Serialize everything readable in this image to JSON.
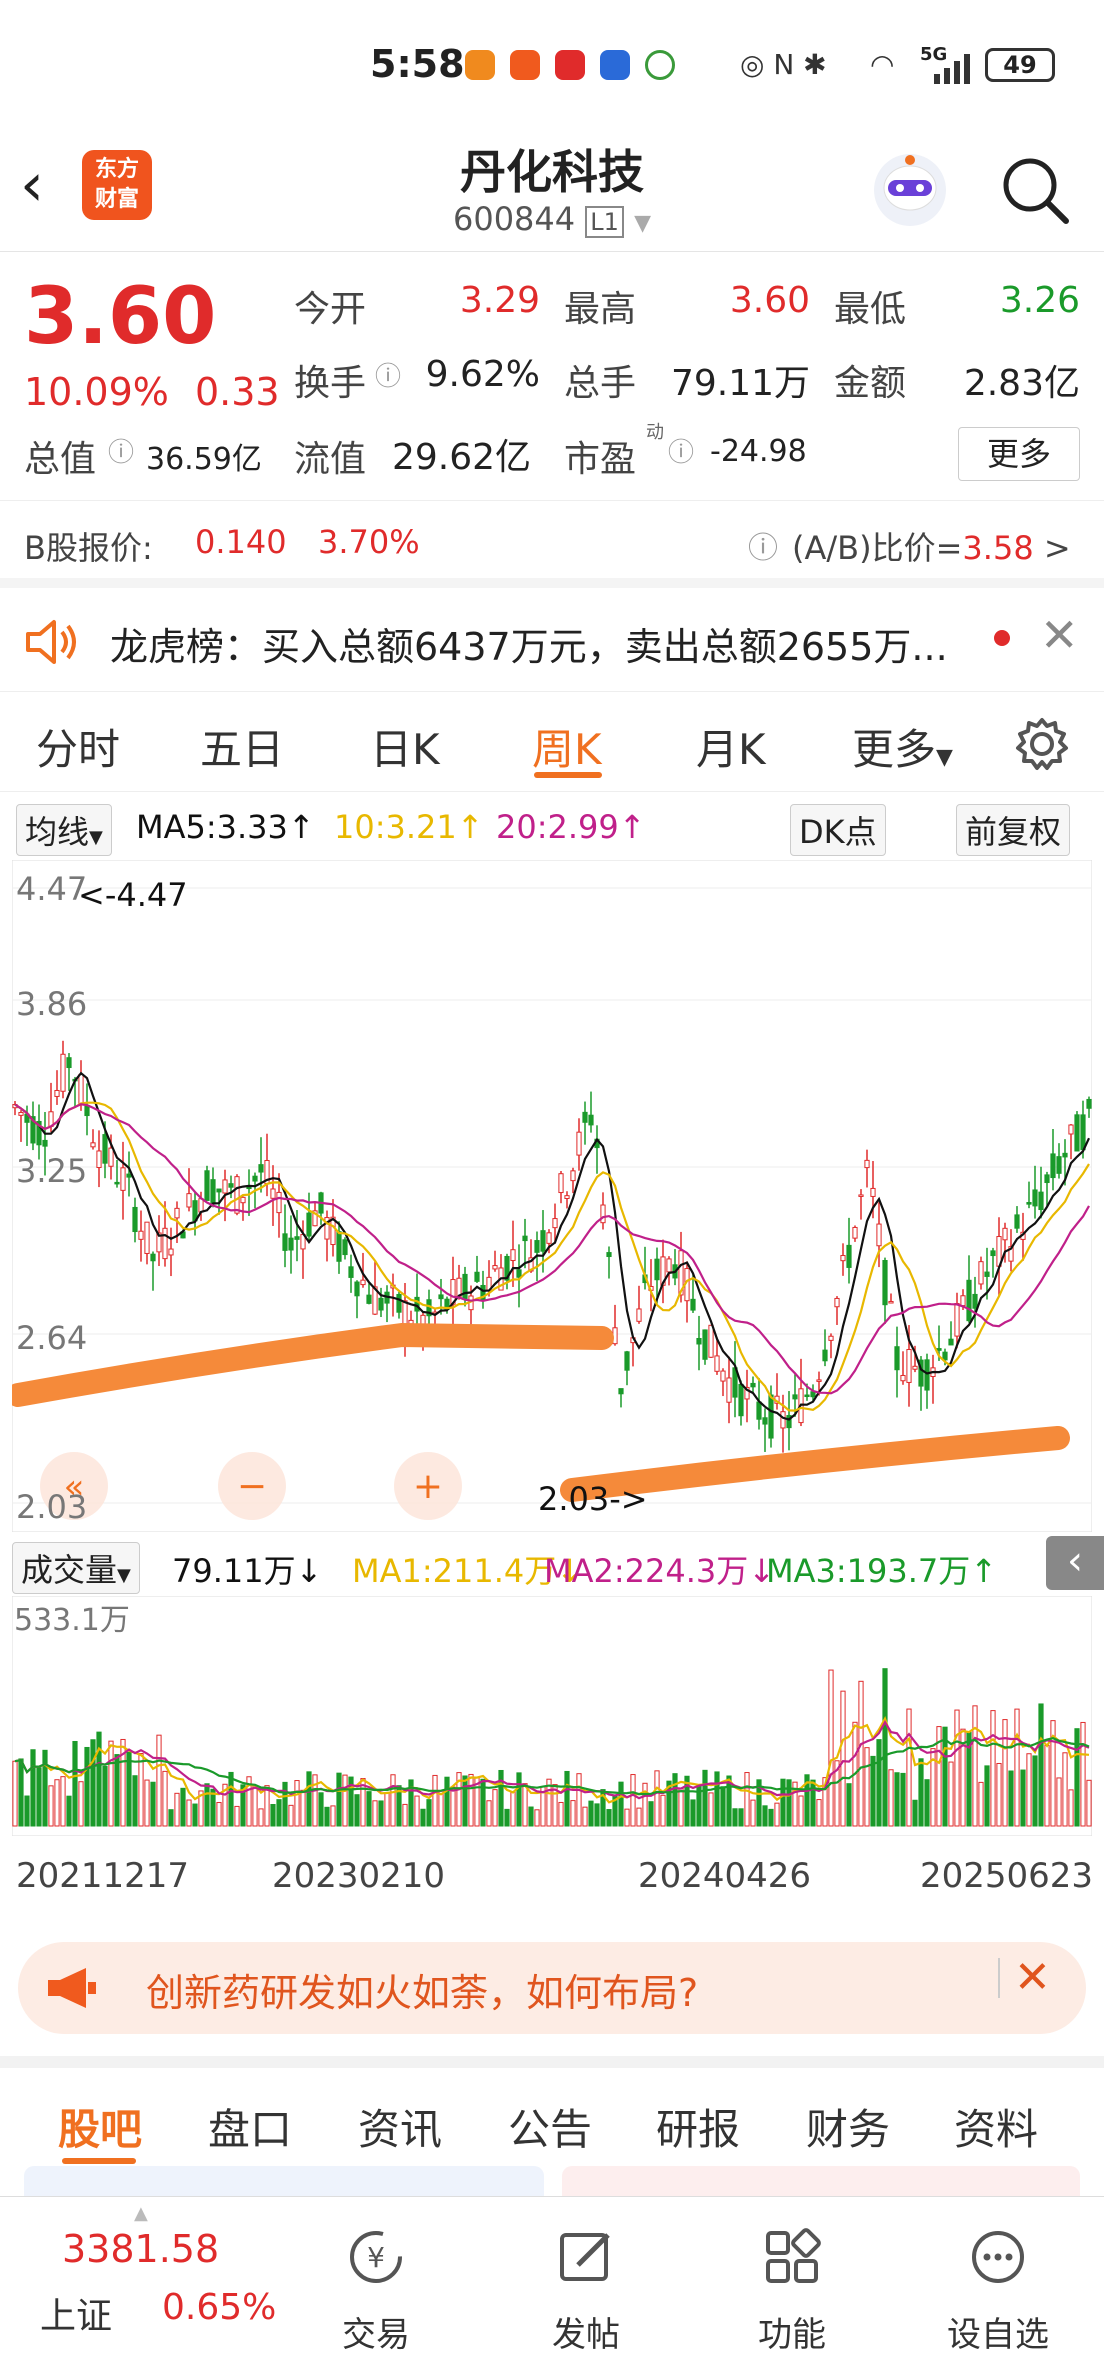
{
  "status_bar": {
    "time": "5:58",
    "network": "5G",
    "battery": "49"
  },
  "header": {
    "logo_text": "东方\n财富",
    "title": "丹化科技",
    "code": "600844",
    "level": "L1"
  },
  "quote": {
    "price": "3.60",
    "change_pct": "10.09%",
    "change_abs": "0.33",
    "open_label": "今开",
    "open": "3.29",
    "high_label": "最高",
    "high": "3.60",
    "low_label": "最低",
    "low": "3.26",
    "turnover_label": "换手",
    "turnover": "9.62%",
    "volume_label": "总手",
    "volume": "79.11万",
    "amount_label": "金额",
    "amount": "2.83亿",
    "mktcap_label": "总值",
    "mktcap": "36.59亿",
    "float_label": "流值",
    "float": "29.62亿",
    "pe_label": "市盈",
    "pe_sup": "动",
    "pe": "-24.98",
    "more": "更多"
  },
  "bshare": {
    "label": "B股报价:",
    "price": "0.140",
    "pct": "3.70%",
    "ratio_label": "(A/B)比价=",
    "ratio": "3.58",
    "arrow": ">"
  },
  "news": {
    "text": "龙虎榜：买入总额6437万元，卖出总额2655万..."
  },
  "tabs": [
    "分时",
    "五日",
    "日K",
    "周K",
    "月K",
    "更多"
  ],
  "active_tab": 3,
  "ma_bar": {
    "selector": "均线",
    "ma5": "MA5:3.33↑",
    "ma10": "10:3.21↑",
    "ma20": "20:2.99↑",
    "dk": "DK点",
    "adjust": "前复权"
  },
  "chart_data": {
    "type": "candlestick",
    "y_ticks": [
      "4.47",
      "3.86",
      "3.25",
      "2.64",
      "2.03"
    ],
    "ylim": [
      2.03,
      4.47
    ],
    "annotations": [
      "<-4.47",
      "2.03->"
    ],
    "volume": {
      "selector": "成交量",
      "current": "79.11万↓",
      "ma1": "MA1:211.4万↓",
      "ma2": "MA2:224.3万↓",
      "ma3": "MA3:193.7万↑",
      "max_label": "533.1万"
    },
    "x_ticks": [
      "20211217",
      "20230210",
      "20240426",
      "20250623"
    ]
  },
  "promo": {
    "text": "创新药研发如火如荼，如何布局?"
  },
  "sub_tabs": [
    "股吧",
    "盘口",
    "资讯",
    "公告",
    "研报",
    "财务",
    "资料"
  ],
  "active_sub_tab": 0,
  "bottom_nav": {
    "index_value": "3381.58",
    "index_name": "上证",
    "index_pct": "0.65%",
    "items": [
      "交易",
      "发帖",
      "功能",
      "设自选"
    ]
  },
  "colors": {
    "up": "#e02b2b",
    "down": "#1a9a2a",
    "accent": "#f07020",
    "ma5": "#111111",
    "ma10": "#e8b800",
    "ma20": "#c0208a"
  }
}
